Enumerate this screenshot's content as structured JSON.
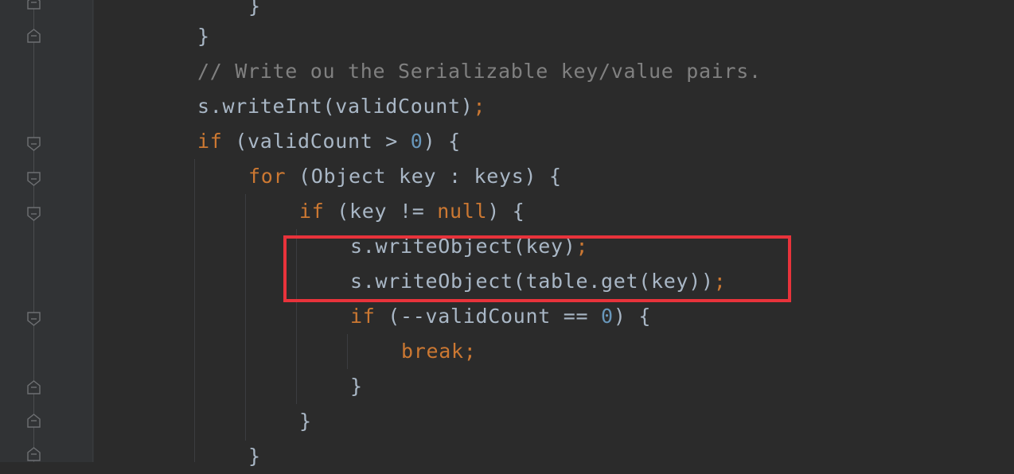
{
  "editor": {
    "lines": [
      {
        "id": "l0",
        "parts": [
          [
            "",
            "}"
          ]
        ]
      },
      {
        "id": "l1",
        "parts": [
          [
            "",
            "}"
          ]
        ]
      },
      {
        "id": "l2",
        "parts": [
          [
            "cmt",
            "// Write ou the Serializable key/value pairs."
          ]
        ]
      },
      {
        "id": "l3",
        "parts": [
          [
            "",
            "s.writeInt(validCount)"
          ],
          [
            "semi",
            ";"
          ]
        ]
      },
      {
        "id": "l4",
        "parts": [
          [
            "kw",
            "if"
          ],
          [
            "",
            " (validCount > "
          ],
          [
            "num",
            "0"
          ],
          [
            "",
            ") {"
          ]
        ]
      },
      {
        "id": "l5",
        "parts": [
          [
            "kw",
            "for"
          ],
          [
            "",
            " (Object key : keys) {"
          ]
        ]
      },
      {
        "id": "l6",
        "parts": [
          [
            "kw",
            "if"
          ],
          [
            "",
            " (key != "
          ],
          [
            "kw",
            "null"
          ],
          [
            "",
            ") {"
          ]
        ]
      },
      {
        "id": "l7",
        "parts": [
          [
            "",
            "s.writeObject(key)"
          ],
          [
            "semi",
            ";"
          ]
        ]
      },
      {
        "id": "l8",
        "parts": [
          [
            "",
            "s.writeObject(table.get(key))"
          ],
          [
            "semi",
            ";"
          ]
        ]
      },
      {
        "id": "l9",
        "parts": [
          [
            "kw",
            "if"
          ],
          [
            "",
            " (--validCount == "
          ],
          [
            "num",
            "0"
          ],
          [
            "",
            ") {"
          ]
        ]
      },
      {
        "id": "l10",
        "parts": [
          [
            "kw",
            "break"
          ],
          [
            "semi",
            ";"
          ]
        ]
      },
      {
        "id": "l11",
        "parts": [
          [
            "",
            "}"
          ]
        ]
      },
      {
        "id": "l12",
        "parts": [
          [
            "",
            "}"
          ]
        ]
      },
      {
        "id": "l13",
        "parts": [
          [
            "",
            "}"
          ]
        ]
      }
    ]
  },
  "colors": {
    "background": "#2b2b2b",
    "gutter": "#313335",
    "text": "#a9b7c6",
    "keyword": "#cc7832",
    "number": "#6897bb",
    "comment": "#808080",
    "highlight": "#e8333b"
  },
  "icons": {
    "fold_open": "fold-start-icon",
    "fold_close": "fold-end-icon"
  }
}
